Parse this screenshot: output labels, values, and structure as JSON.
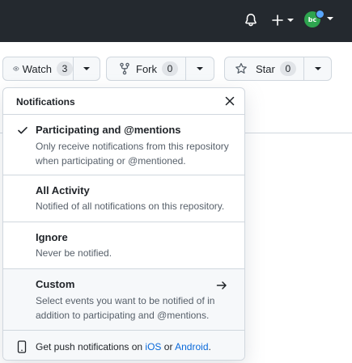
{
  "header": {
    "icons": [
      "bell-icon",
      "plus-icon",
      "chevron-down-icon"
    ],
    "avatar_initials": "bc"
  },
  "repo_actions": {
    "watch": {
      "label": "Watch",
      "count": "3"
    },
    "fork": {
      "label": "Fork",
      "count": "0"
    },
    "star": {
      "label": "Star",
      "count": "0"
    }
  },
  "notifications_menu": {
    "title": "Notifications",
    "options": [
      {
        "title": "Participating and @mentions",
        "description": "Only receive notifications from this repository when participating or @mentioned.",
        "selected": true
      },
      {
        "title": "All Activity",
        "description": "Notified of all notifications on this repository.",
        "selected": false
      },
      {
        "title": "Ignore",
        "description": "Never be notified.",
        "selected": false
      },
      {
        "title": "Custom",
        "description": "Select events you want to be notified of in addition to participating and @mentions.",
        "selected": false
      }
    ],
    "footer": {
      "prefix": "Get push notifications on ",
      "ios_link": "iOS",
      "joiner": " or ",
      "android_link": "Android",
      "suffix": "."
    }
  },
  "colors": {
    "topbar": "#24292f",
    "link": "#0969da",
    "border": "#d0d7de",
    "button_bg": "#f6f8fa"
  }
}
